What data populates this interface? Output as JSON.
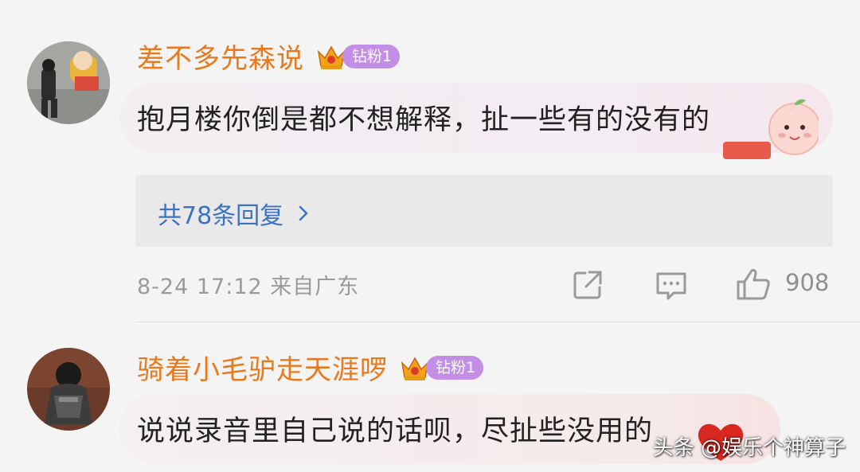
{
  "comments": [
    {
      "username": "差不多先森说",
      "badge": "钻粉1",
      "text": "抱月楼你倒是都不想解释，扯一些有的没有的",
      "replies_link": "共78条回复",
      "meta": "8-24 17:12  来自广东",
      "likes": "908"
    },
    {
      "username": "骑着小毛驴走天涯啰",
      "badge": "钻粉1",
      "text": "说说录音里自己说的话呗，尽扯些没用的"
    }
  ],
  "watermark": "头条 @娱乐个神算子",
  "colors": {
    "username": "#e8791c",
    "badge": "#c48ee6",
    "link": "#3d72c0"
  },
  "icons": [
    "crown-icon",
    "chevron-right-icon",
    "share-icon",
    "comment-icon",
    "like-icon",
    "peach-sticker-icon"
  ]
}
